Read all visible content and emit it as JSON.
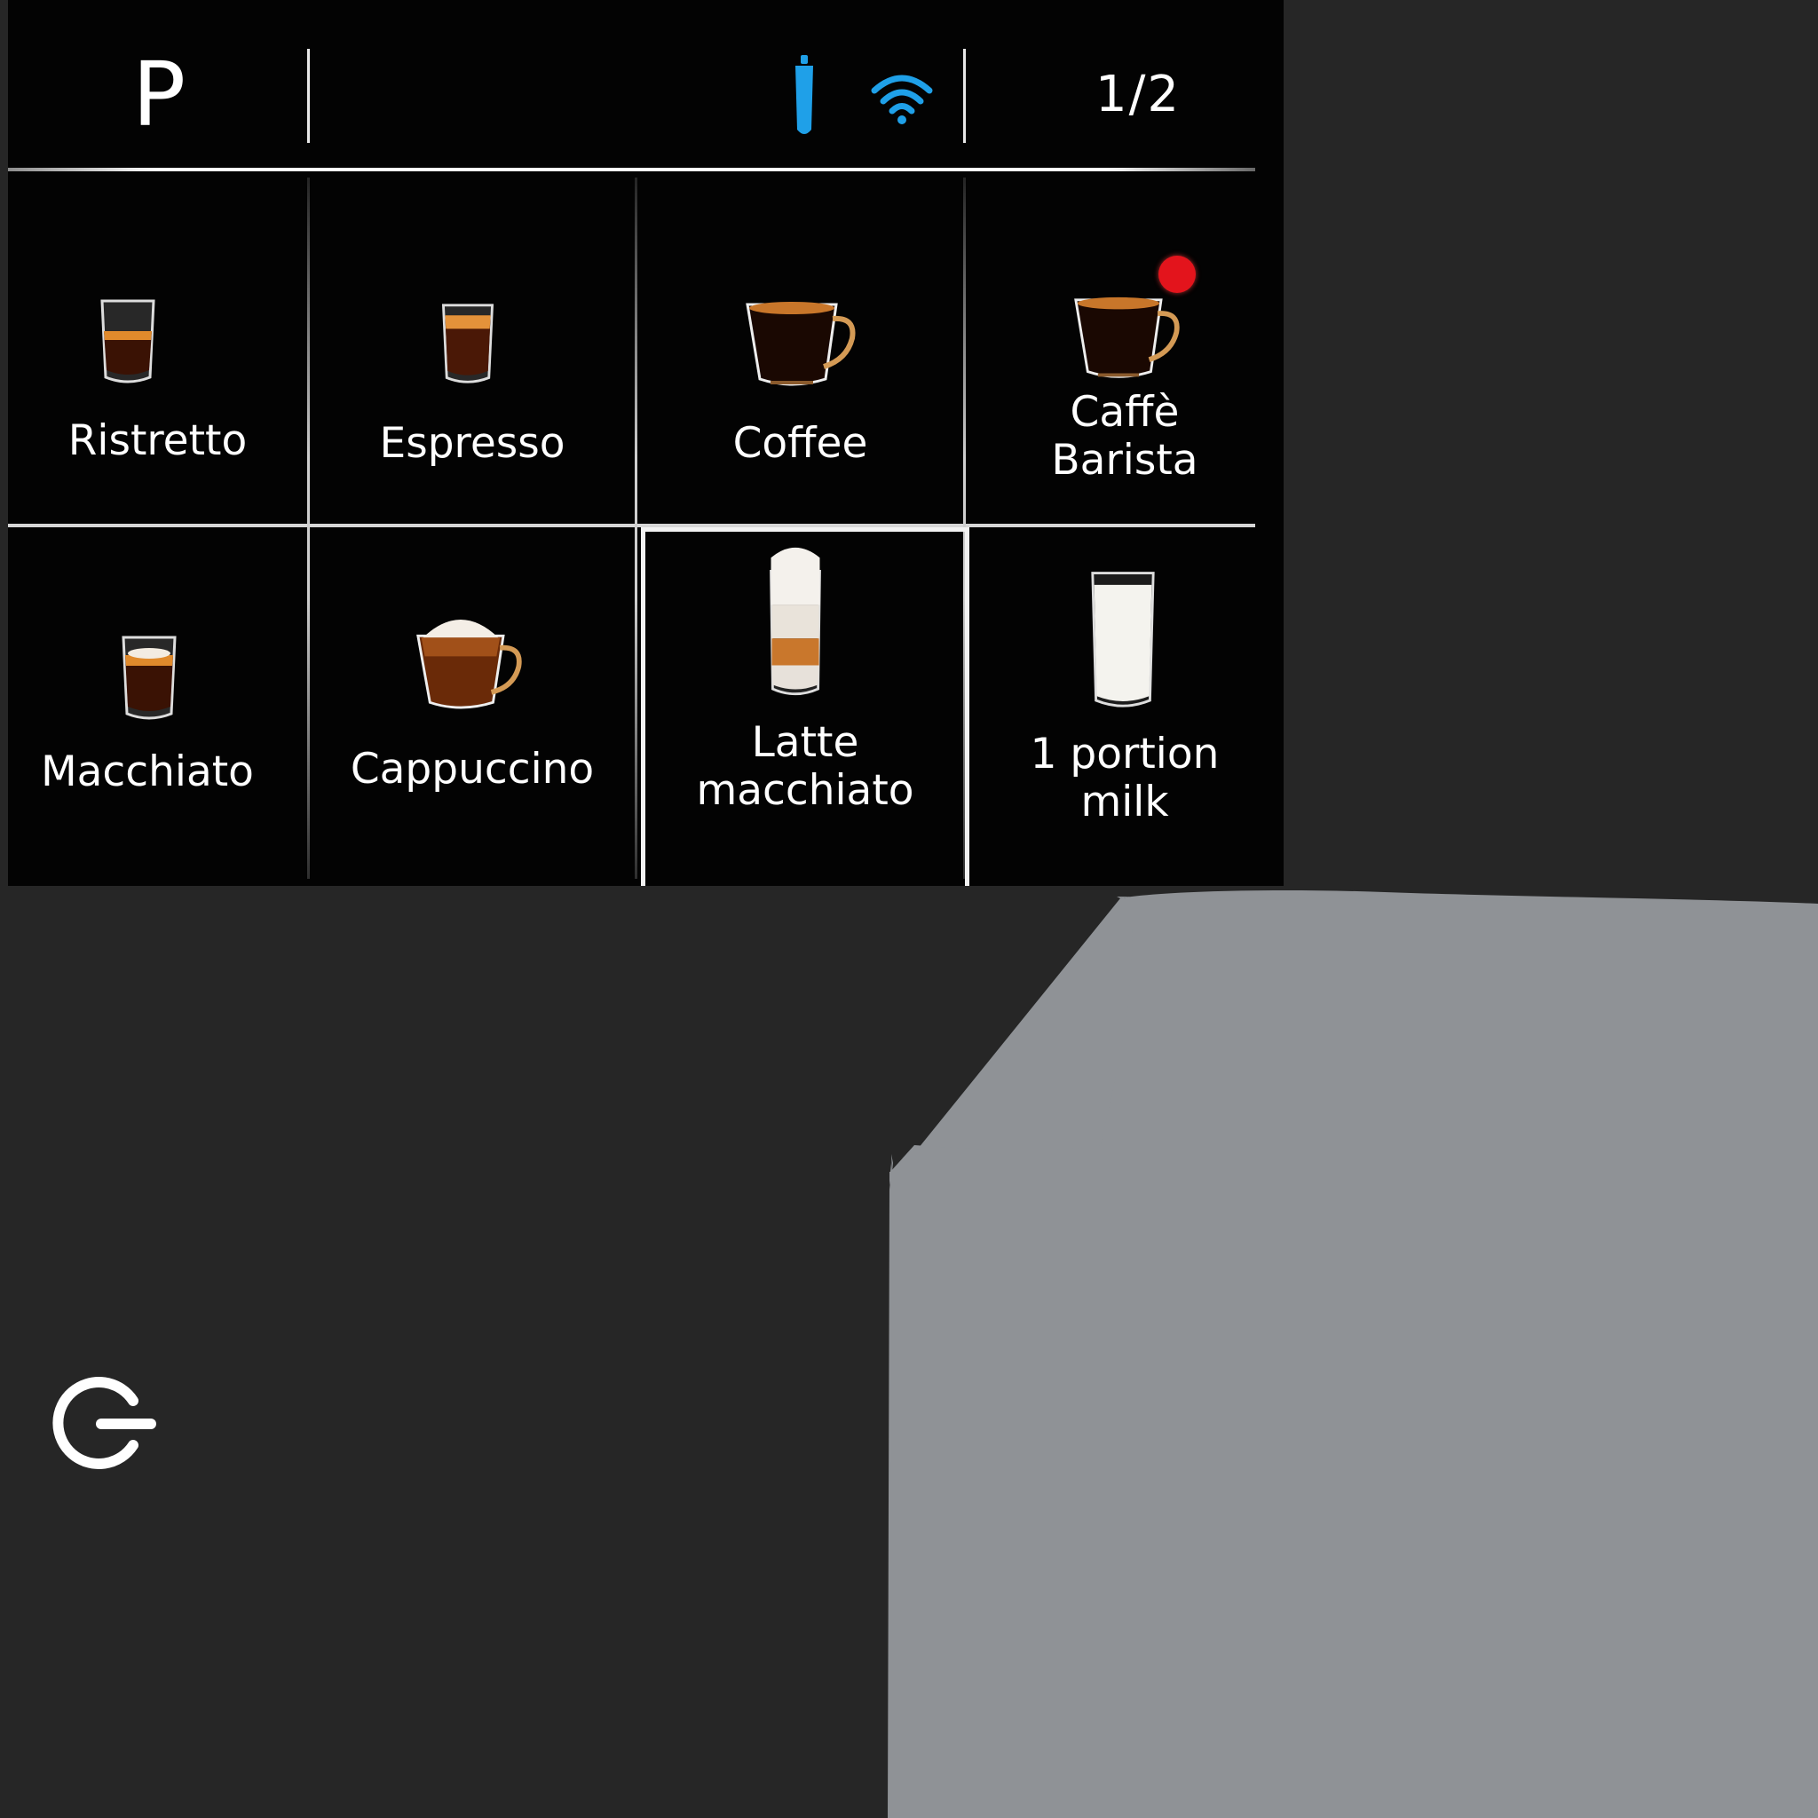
{
  "topbar": {
    "p_label": "P",
    "page_indicator": "1/2",
    "filter_icon": "water-filter-icon",
    "wifi_icon": "wifi-icon",
    "accent_color": "#1fa0e8"
  },
  "drinks": [
    {
      "label": "Ristretto",
      "icon": "small-glass-espresso-icon"
    },
    {
      "label": "Espresso",
      "icon": "glass-espresso-icon"
    },
    {
      "label": "Coffee",
      "icon": "coffee-cup-icon"
    },
    {
      "label": "Caffè\nBarista",
      "icon": "coffee-cup-icon",
      "badge": "barista-badge-icon"
    },
    {
      "label": "Macchiato",
      "icon": "macchiato-glass-icon"
    },
    {
      "label": "Cappuccino",
      "icon": "cappuccino-cup-icon"
    },
    {
      "label": "Latte\nmacchiato",
      "icon": "latte-glass-icon",
      "selected": true
    },
    {
      "label": "1 portion\nmilk",
      "icon": "milk-glass-icon"
    }
  ],
  "power_icon": "power-icon",
  "colors": {
    "screen_bg": "#030303",
    "device_dark": "#262626",
    "device_grey": "#8f9296",
    "badge_red": "#e3141c"
  }
}
